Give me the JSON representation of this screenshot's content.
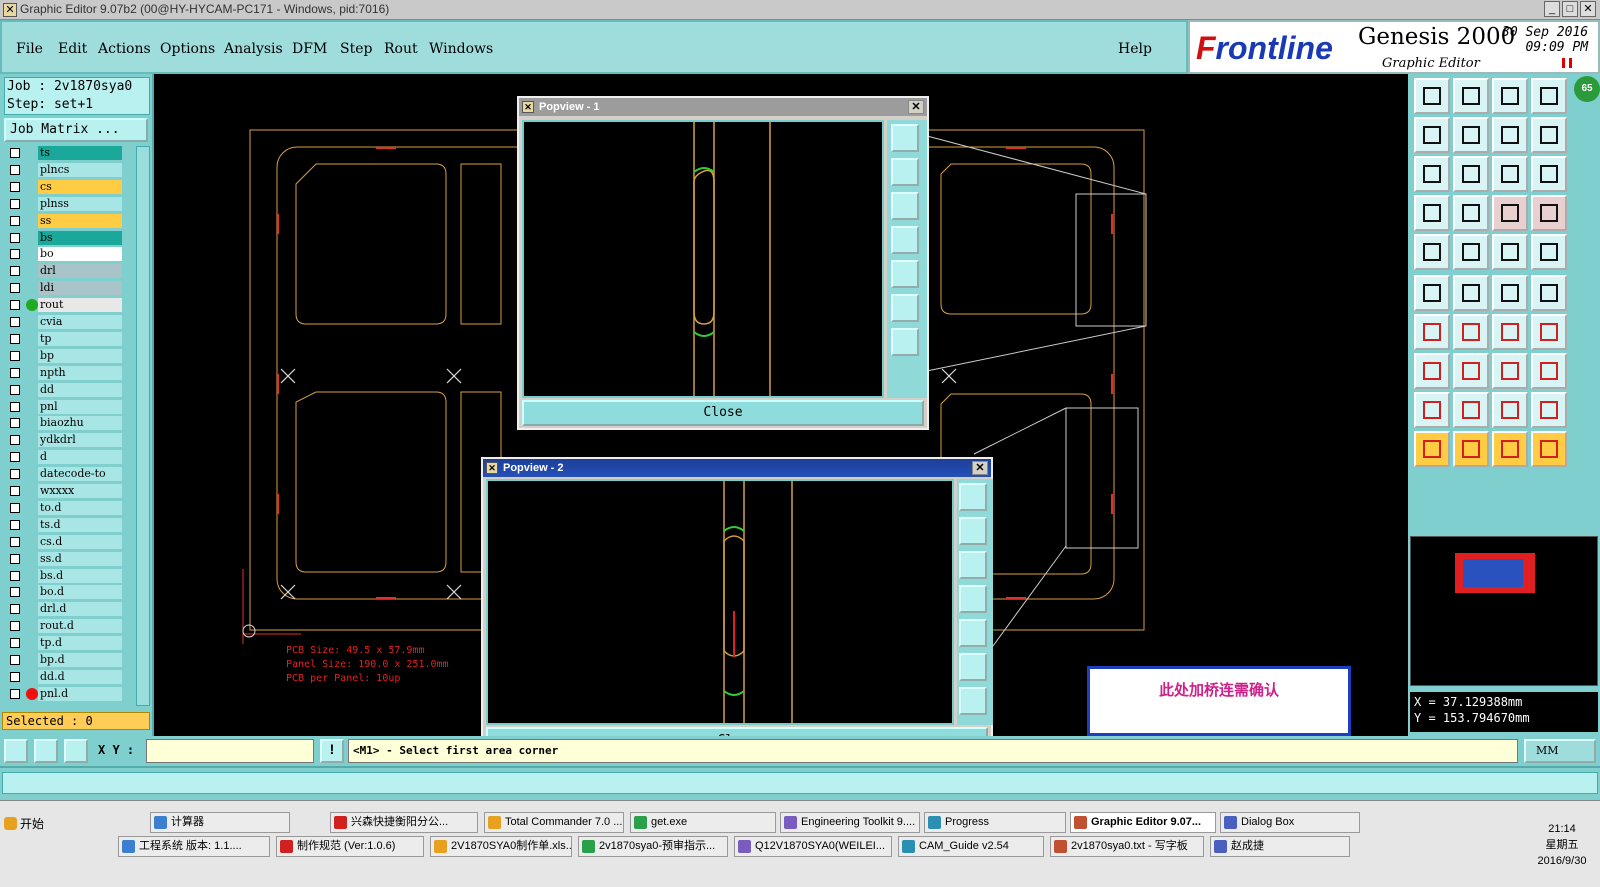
{
  "window": {
    "title": "Graphic Editor 9.07b2 (00@HY-HYCAM-PC171 - Windows, pid:7016)"
  },
  "menu": {
    "items": [
      "File",
      "Edit",
      "Actions",
      "Options",
      "Analysis",
      "DFM",
      "Step",
      "Rout",
      "Windows"
    ],
    "help": "Help"
  },
  "brand": {
    "logo_f": "F",
    "logo_rest": "rontline",
    "product": "Genesis 2000",
    "subtitle": "Graphic Editor",
    "date": "30 Sep 2016",
    "time": "09:09 PM"
  },
  "job": {
    "job": "Job : 2v1870sya0",
    "step": "Step: set+1",
    "matrix_button": "Job Matrix ..."
  },
  "layers": [
    {
      "name": "ts",
      "color": "#1aa89a"
    },
    {
      "name": "plncs",
      "color": "#a8e6e6"
    },
    {
      "name": "cs",
      "color": "#ffcc44"
    },
    {
      "name": "plnss",
      "color": "#a8e6e6"
    },
    {
      "name": "ss",
      "color": "#ffcc44"
    },
    {
      "name": "bs",
      "color": "#1aa89a"
    },
    {
      "name": "bo",
      "color": "#ffffff"
    },
    {
      "name": "drl",
      "color": "#a8c4c8"
    },
    {
      "name": "ldi",
      "color": "#a8c4c8"
    },
    {
      "name": "rout",
      "color": "#e8e8e8",
      "dot": "#22aa22"
    },
    {
      "name": "cvia",
      "color": "#a8e6e6"
    },
    {
      "name": "tp",
      "color": "#a8e6e6"
    },
    {
      "name": "bp",
      "color": "#a8e6e6"
    },
    {
      "name": "npth",
      "color": "#a8e6e6"
    },
    {
      "name": "dd",
      "color": "#a8e6e6"
    },
    {
      "name": "pnl",
      "color": "#a8e6e6"
    },
    {
      "name": "biaozhu",
      "color": "#a8e6e6"
    },
    {
      "name": "ydkdrl",
      "color": "#a8e6e6"
    },
    {
      "name": "d",
      "color": "#a8e6e6"
    },
    {
      "name": "datecode-to",
      "color": "#a8e6e6"
    },
    {
      "name": "wxxxx",
      "color": "#a8e6e6"
    },
    {
      "name": "to.d",
      "color": "#a8e6e6"
    },
    {
      "name": "ts.d",
      "color": "#a8e6e6"
    },
    {
      "name": "cs.d",
      "color": "#a8e6e6"
    },
    {
      "name": "ss.d",
      "color": "#a8e6e6"
    },
    {
      "name": "bs.d",
      "color": "#a8e6e6"
    },
    {
      "name": "bo.d",
      "color": "#a8e6e6"
    },
    {
      "name": "drl.d",
      "color": "#a8e6e6"
    },
    {
      "name": "rout.d",
      "color": "#a8e6e6"
    },
    {
      "name": "tp.d",
      "color": "#a8e6e6"
    },
    {
      "name": "bp.d",
      "color": "#a8e6e6"
    },
    {
      "name": "dd.d",
      "color": "#a8e6e6"
    },
    {
      "name": "pnl.d",
      "color": "#a8e6e6",
      "dot": "#ee1111"
    }
  ],
  "selected": "Selected : 0",
  "popview1": {
    "title": "Popview - 1",
    "close": "Close"
  },
  "popview2": {
    "title": "Popview - 2",
    "close": "Close"
  },
  "pcb_text": [
    "PCB Size: 49.5 x 57.9mm",
    "Panel Size: 190.0 x 251.0mm",
    "PCB per Panel: 10up"
  ],
  "note": "此处加桥连需确认",
  "coords": {
    "x": "X = 37.129388mm",
    "y": "Y = 153.794670mm"
  },
  "prompt": {
    "xy_label": "X Y :",
    "message": "<M1> - Select first area corner",
    "units": "MM"
  },
  "badge": "65",
  "taskbar": {
    "start": "开始",
    "row1": [
      "计算器",
      "兴森快捷衡阳分公...",
      "Total Commander 7.0 ...",
      "get.exe",
      "Engineering Toolkit 9....",
      "Progress",
      "Graphic Editor 9.07...",
      "Dialog Box"
    ],
    "row2": [
      "工程系统  版本: 1.1....",
      "制作规范 (Ver:1.0.6)",
      "2V1870SYA0制作单.xls...",
      "2v1870sya0-预审指示...",
      "Q12V1870SYA0(WEILEI...",
      "CAM_Guide v2.54",
      "2v1870sya0.txt - 写字板",
      "赵成捷"
    ],
    "clock": "21:14",
    "weekday": "星期五",
    "date": "2016/9/30"
  }
}
